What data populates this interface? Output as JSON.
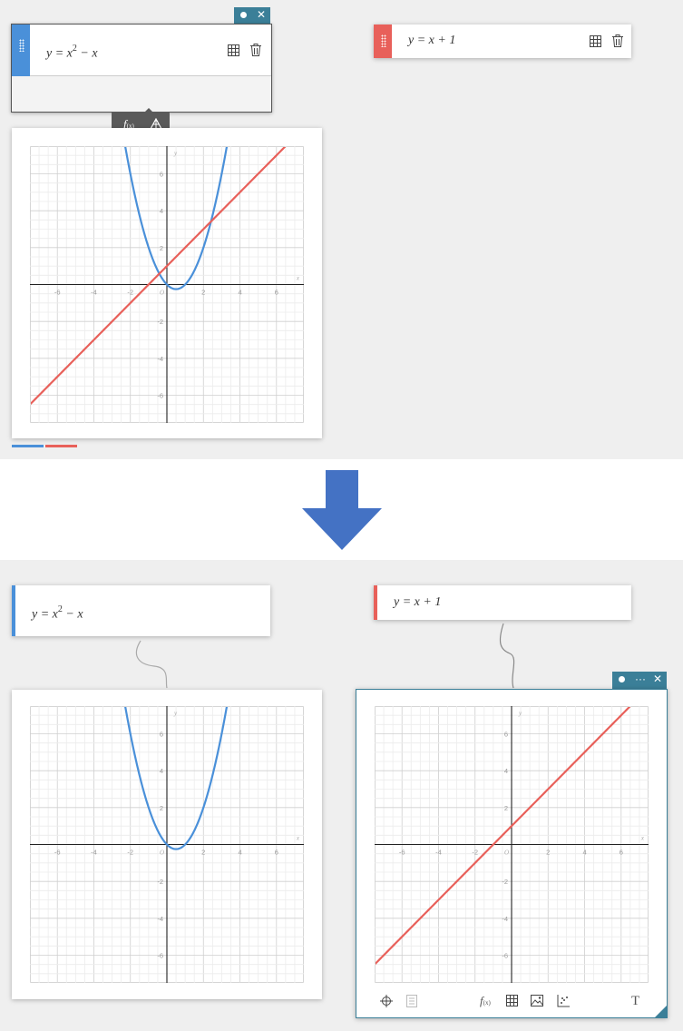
{
  "equations": {
    "eq1": {
      "prefix": "y = x",
      "power": "2",
      "suffix": " − x",
      "color": "#4a90d9"
    },
    "eq2": {
      "text": "y = x + 1",
      "color": "#e8605a"
    }
  },
  "axis": {
    "x_label": "x",
    "y_label": "y",
    "origin_label": "O",
    "x_ticks": [
      "-6",
      "-4",
      "-2",
      "2",
      "4",
      "6"
    ],
    "y_ticks": [
      "6",
      "4",
      "2",
      "-2",
      "-4",
      "-6"
    ]
  },
  "toolbar_popup": {
    "function_label": "f(x)",
    "function_sub": "(x)",
    "function_main": "f"
  },
  "bottom_toolbar": {
    "text_tool": "T",
    "function_main": "f",
    "function_sub": "(x)"
  },
  "pin_menu": {
    "more": "···",
    "close": "✕"
  },
  "colors": {
    "blue": "#4a90d9",
    "red": "#e8605a",
    "accent": "#3b7f98",
    "arrow": "#4472c4"
  },
  "chart_data": [
    {
      "type": "line",
      "title": "",
      "xlim": [
        -7.5,
        7.5
      ],
      "ylim": [
        -7.5,
        7.5
      ],
      "grid": true,
      "series": [
        {
          "name": "y = x² − x",
          "fn": "x^2-x",
          "color": "#4a90d9"
        },
        {
          "name": "y = x + 1",
          "fn": "x+1",
          "color": "#e8605a"
        }
      ]
    },
    {
      "type": "line",
      "title": "",
      "xlim": [
        -7.5,
        7.5
      ],
      "ylim": [
        -7.5,
        7.5
      ],
      "grid": true,
      "series": [
        {
          "name": "y = x² − x",
          "fn": "x^2-x",
          "color": "#4a90d9"
        }
      ]
    },
    {
      "type": "line",
      "title": "",
      "xlim": [
        -7.5,
        7.5
      ],
      "ylim": [
        -7.5,
        7.5
      ],
      "grid": true,
      "series": [
        {
          "name": "y = x + 1",
          "fn": "x+1",
          "color": "#e8605a"
        }
      ]
    }
  ]
}
